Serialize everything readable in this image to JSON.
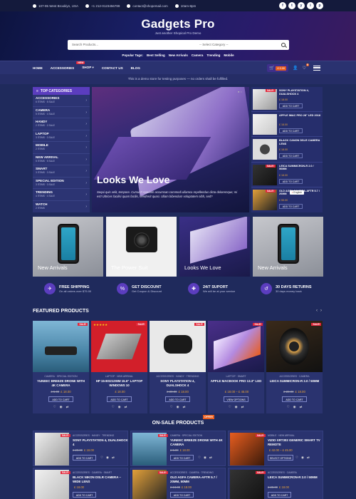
{
  "topbar": {
    "address": "107-95 West Brooklyn, USA",
    "phone": "+1 212-0123456789",
    "email": "contact@shopemail.com",
    "hours": "10am-8pm",
    "socials": [
      "f",
      "t",
      "y",
      "i",
      "p"
    ]
  },
  "header": {
    "brand": "Gadgets Pro",
    "tagline": "Just another Shopical Pro Demo",
    "search_placeholder": "Search Products...",
    "category_select": "-- Select Category --",
    "popular_label": "Popular Tags:",
    "tags": [
      "Best Selling",
      "New Arrivals",
      "Camera",
      "Trending",
      "Mobile"
    ]
  },
  "nav": {
    "items": [
      "HOME",
      "ACCESSORIES",
      "SHOP",
      "CONTACT US",
      "BLOG"
    ],
    "new_badge": "NEW",
    "shop_caret": "▾",
    "cart_total": "£ 0.00",
    "cart_count": "0",
    "wishlist_count": "0"
  },
  "notice": "This is a demo store for testing purposes — no orders shall be fulfilled.",
  "categories": {
    "title": "TOP CATEGORIES",
    "items": [
      {
        "name": "ACCESSORIES",
        "count": "6 ITEMS · 8 SALE"
      },
      {
        "name": "CAMERA",
        "count": "5 ITEMS · 4 SALE"
      },
      {
        "name": "HANDY",
        "count": "2 ITEMS · 2 SALE"
      },
      {
        "name": "LAPTOP",
        "count": "3 ITEMS · 3 SALE"
      },
      {
        "name": "MOBILE",
        "count": "2 ITEMS"
      },
      {
        "name": "NEW ARRIVAL",
        "count": "5 ITEMS · 5 SALE"
      },
      {
        "name": "SMART",
        "count": "3 ITEMS · 3 SALE"
      },
      {
        "name": "SPECIAL EDITION",
        "count": "3 ITEMS · 3 SALE"
      },
      {
        "name": "TRENDING",
        "count": "4 ITEMS · 4 SALE"
      },
      {
        "name": "WATCH",
        "count": "2 ITEMS"
      }
    ]
  },
  "hero": {
    "title": "Looks We Love",
    "text": "Sequi quis velit, tempore. Cursus? Aperiam accumsan commodi ullamco repellendus dicta doloremque; mi est! Ultrices facilisi quam facilis, hendrerit quasi. Ullam bibendum voluptatem nibh, sed?"
  },
  "side_products": [
    {
      "name": "SONY PLAYSTATION 4, DUALSHOCK 4",
      "button": "ADD TO CART",
      "sale": "SALE!"
    },
    {
      "name": "APPLE IMAC PRO 28\" LED 2018",
      "button": "ADD TO CART",
      "sale": ""
    },
    {
      "name": "BLACK CANON DSLR CAMERA LENS",
      "button": "ADD TO CART",
      "sale": ""
    },
    {
      "name": "LEICA SUMMICRON-R 2.0 / 50MM",
      "button": "ADD TO CART",
      "sale": "SALE!"
    },
    {
      "name": "OLD AGFA CAMERA-AFTR 5.7 / 20MM",
      "button": "ADD TO CART",
      "sale": "SALE!"
    }
  ],
  "side_product_prices": [
    "£ 18.00",
    "£ 18.00",
    "£ 18.00",
    "£ 18.00",
    "£ 55.00"
  ],
  "lang_popup": "English",
  "banners": [
    "New Arrivals",
    "The Power Suit",
    "Looks We Love",
    "New Arrivals"
  ],
  "features": [
    {
      "title": "FREE SHIPPING",
      "sub": "On all orders over $75.00",
      "icon": "✈"
    },
    {
      "title": "GET DISCOUNT",
      "sub": "Get Coupon & Discount",
      "icon": "%"
    },
    {
      "title": "24/7 SUPORT",
      "sub": "We will be at your service",
      "icon": "✚"
    },
    {
      "title": "30 DAYS RETURNS",
      "sub": "30 days money back",
      "icon": "↺"
    }
  ],
  "featured": {
    "title": "FEATURED PRODUCTS",
    "products": [
      {
        "cat": "CAMERA · SPECIAL EDITION",
        "name": "YUNEEC BREEZE DRONE WITH 4K CAMERA",
        "old": "£ 5.00",
        "price": "£ 18.00",
        "button": "ADD TO CART",
        "sale": "SALE!"
      },
      {
        "cat": "LAPTOP · NEW ARRIVAL",
        "name": "HP 15-BS212WM 15.6\" LAPTOP WINDOWS 10",
        "old": "",
        "price": "£ 18.00",
        "button": "ADD TO CART",
        "sale": "SALE!"
      },
      {
        "cat": "ACCESSORIES · HANDY · TRENDING",
        "name": "SONY PLAYSTATION 4, DUALSHOCK 4",
        "old": "£ 20.00",
        "price": "£ 18.00",
        "button": "ADD TO CART",
        "sale": "SALE!"
      },
      {
        "cat": "LAPTOP · SMART",
        "name": "APPLE MACBOOK PRO 13.3\" LED",
        "old": "",
        "price": "£ 18.00 – £ 45.00",
        "button": "VIEW OPTIONS",
        "sale": "SALE!"
      },
      {
        "cat": "ACCESSORIES · CAMERA",
        "name": "LEICA SUMMICRON-R 2.0 / 50MM",
        "old": "£ 28.00",
        "price": "£ 18.00",
        "button": "ADD TO CART",
        "sale": "SALE!"
      }
    ]
  },
  "onsale": {
    "title": "ON-SALE PRODUCTS",
    "badge": "OFFER",
    "products": [
      {
        "cat": "ACCESSORIES · HANDY · TRENDING",
        "name": "SONY PLAYSTATION 4, DUALSHOCK 4",
        "old": "£ 20.00",
        "price": "£ 18.00",
        "button": "ADD TO CART"
      },
      {
        "cat": "CAMERA · SPECIAL EDITION",
        "name": "YUNEEC BREEZE DRONE WITH 4K CAMERA",
        "old": "£ 5.00",
        "price": "£ 18.00",
        "button": "ADD TO CART"
      },
      {
        "cat": "MOBILE · NEW ARRIVAL",
        "name": "VIZIO XRT302 GENERIC SMART TV REMOTE",
        "old": "",
        "price": "£ 42.00 – £ 45.00",
        "button": "SELECT OPTIONS"
      },
      {
        "cat": "ACCESSORIES · CAMERA · SMART",
        "name": "BLACK NIKON DSLR CAMERA – WIDE LENS",
        "old": "",
        "price": "£ 18.00",
        "button": "ADD TO CART"
      },
      {
        "cat": "ACCESSORIES · CAMERA · TRENDING",
        "name": "OLD AGFA CAMERA-AFTR 5.7 / 20MM, 50MM",
        "old": "£ 24.00",
        "price": "£ 18.00",
        "button": "ADD TO CART"
      },
      {
        "cat": "ACCESSORIES · CAMERA",
        "name": "LEICA SUMMICRON-R 2.0 / 50MM",
        "old": "£ 28.00",
        "price": "£ 18.00",
        "button": "ADD TO CART"
      }
    ]
  }
}
